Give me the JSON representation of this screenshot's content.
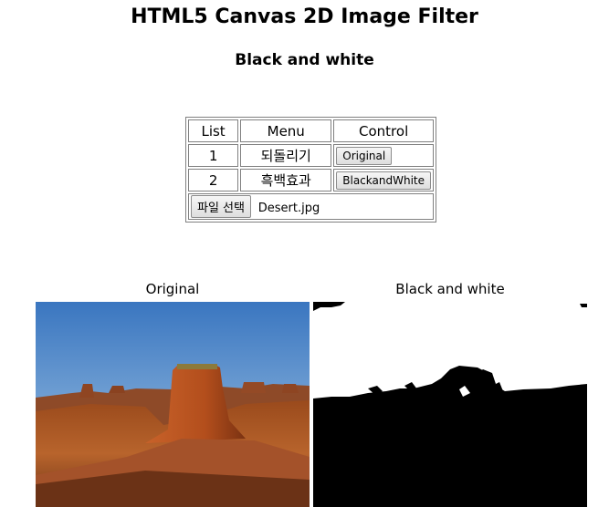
{
  "page": {
    "title": "HTML5 Canvas 2D Image Filter",
    "subtitle": "Black and white"
  },
  "table": {
    "headers": [
      "List",
      "Menu",
      "Control"
    ],
    "rows": [
      {
        "no": "1",
        "menu": "되돌리기",
        "button": "Original"
      },
      {
        "no": "2",
        "menu": "흑백효과",
        "button": "BlackandWhite"
      }
    ],
    "file_button": "파일 선택",
    "file_name": "Desert.jpg"
  },
  "images": {
    "original_label": "Original",
    "filtered_label": "Black and white"
  },
  "colors": {
    "sky": "#3f7fc2",
    "rock": "#b05a22",
    "filtered_bg": "#000000",
    "filtered_fg": "#ffffff"
  }
}
